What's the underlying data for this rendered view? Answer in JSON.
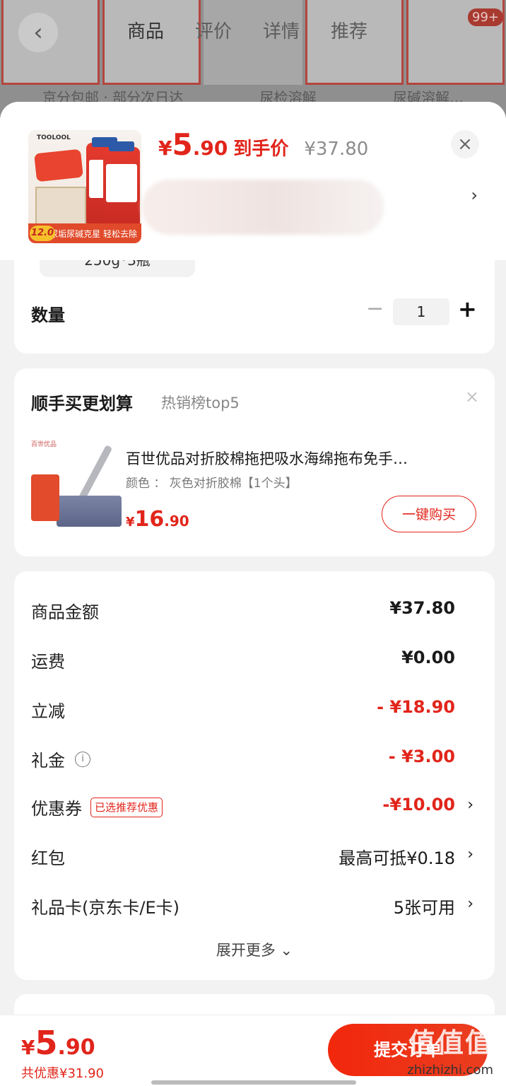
{
  "background": {
    "tabs": [
      "商品",
      "评价",
      "详情",
      "推荐"
    ],
    "badge": "99+",
    "texts": [
      "京分包邮 · 部分次日达",
      "尿检溶解",
      "尿碱溶解…"
    ]
  },
  "header": {
    "price_symbol": "¥",
    "price_int": "5",
    "price_dec": ".90",
    "price_tag": "到手价",
    "original_price": "¥37.80",
    "close": "×",
    "arrow": "›",
    "thumb_brand": "TOOLOOL",
    "thumb_slogan": "尿垢尿碱克星 轻松去除",
    "thumb_price": "12.0"
  },
  "spec": {
    "selected": "250g*3瓶"
  },
  "quantity": {
    "label": "数量",
    "minus": "−",
    "value": "1",
    "plus": "+"
  },
  "recommend": {
    "title": "顺手买更划算",
    "subtitle": "热销榜top5",
    "close": "×",
    "brand": "百世优品",
    "product_name": "百世优品对折胶棉拖把吸水海绵拖布免手…",
    "spec": "颜色 ： 灰色对折胶棉【1个头】",
    "price_symbol": "¥",
    "price_int": "16",
    "price_dec": ".90",
    "buy_label": "一键购买"
  },
  "summary": {
    "rows": [
      {
        "label": "商品金额",
        "value": "¥37.80"
      },
      {
        "label": "运费",
        "value": "¥0.00"
      },
      {
        "label": "立减",
        "value": "- ¥18.90"
      },
      {
        "label": "礼金",
        "value": "- ¥3.00"
      },
      {
        "label": "优惠券",
        "value": "-¥10.00",
        "tag": "已选推荐优惠"
      },
      {
        "label": "红包",
        "value": "最高可抵¥0.18"
      },
      {
        "label": "礼品卡(京东卡/E卡)",
        "value": "5张可用"
      }
    ],
    "arrow": "›",
    "info_icon": "i",
    "expand": "展开更多 ⌄"
  },
  "footer": {
    "price_symbol": "¥",
    "price_int": "5",
    "price_dec": ".90",
    "saved": "共优惠¥31.90",
    "submit": "提交订单",
    "watermark": "值值值",
    "watermark_url": "zhizhizhi.com"
  },
  "colors": {
    "accent": "#e1251b",
    "background": "#f2f2f2"
  }
}
